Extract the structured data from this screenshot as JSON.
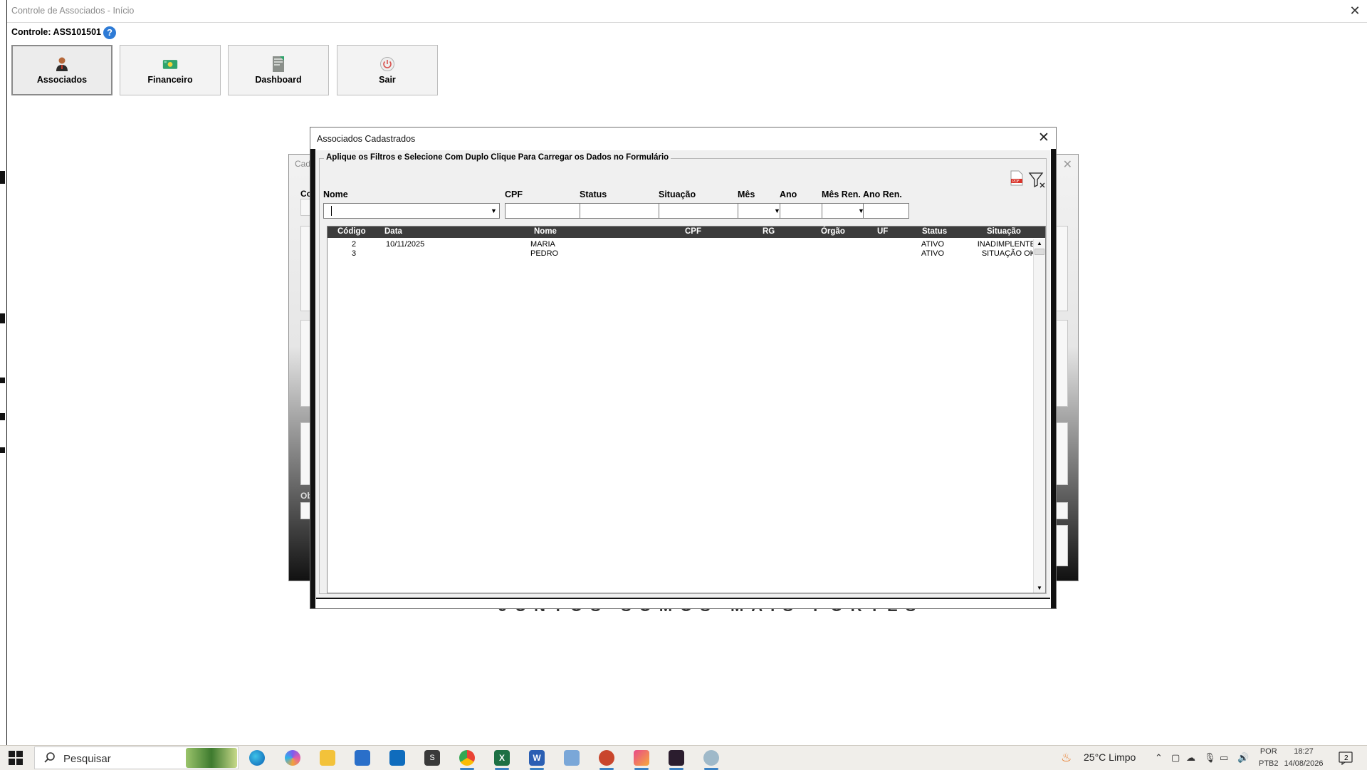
{
  "window": {
    "title": "Controle de Associados - Início",
    "close_glyph": "✕"
  },
  "control": {
    "label": "Controle: ASS101501",
    "help_glyph": "?"
  },
  "nav": [
    {
      "label": "Associados",
      "icon": "person-icon"
    },
    {
      "label": "Financeiro",
      "icon": "money-icon"
    },
    {
      "label": "Dashboard",
      "icon": "report-icon"
    },
    {
      "label": "Sair",
      "icon": "power-icon"
    }
  ],
  "back_form": {
    "title": "Cad",
    "close_glyph": "✕",
    "field_fragments": [
      "Co",
      "Ob"
    ],
    "slogan": "JUNTOS SOMOS MAIS FORTES"
  },
  "dialog": {
    "title": "Associados Cadastrados",
    "close_glyph": "✕",
    "frame_caption": "Aplique os Filtros e Selecione Com Duplo Clique Para Carregar os Dados no Formulário",
    "filters": {
      "nome": {
        "label": "Nome",
        "value": ""
      },
      "cpf": {
        "label": "CPF",
        "value": ""
      },
      "status": {
        "label": "Status",
        "value": ""
      },
      "situacao": {
        "label": "Situação",
        "value": ""
      },
      "mes": {
        "label": "Mês",
        "value": ""
      },
      "ano": {
        "label": "Ano",
        "value": ""
      },
      "mes_ren": {
        "label": "Mês Ren.",
        "value": ""
      },
      "ano_ren": {
        "label": "Ano Ren.",
        "value": ""
      }
    },
    "columns": [
      "Código",
      "Data",
      "Nome",
      "CPF",
      "RG",
      "Órgão",
      "UF",
      "Status",
      "Situação"
    ],
    "rows": [
      [
        "2",
        "10/11/2025",
        "MARIA",
        "",
        "",
        "",
        "",
        "ATIVO",
        "INADIMPLENTE"
      ],
      [
        "3",
        "",
        "PEDRO",
        "",
        "",
        "",
        "",
        "ATIVO",
        "SITUAÇÃO OK"
      ]
    ]
  },
  "taskbar": {
    "search_placeholder": "Pesquisar",
    "weather": "25°C  Limpo",
    "lang_line1": "POR",
    "lang_line2": "PTB2",
    "time": "18:27",
    "date": "14/08/2026",
    "notification_count": "2"
  },
  "colors": {
    "accent": "#2e7bd6",
    "header_bg": "#3c3c3c",
    "taskbar_bg": "#f0eeea"
  }
}
